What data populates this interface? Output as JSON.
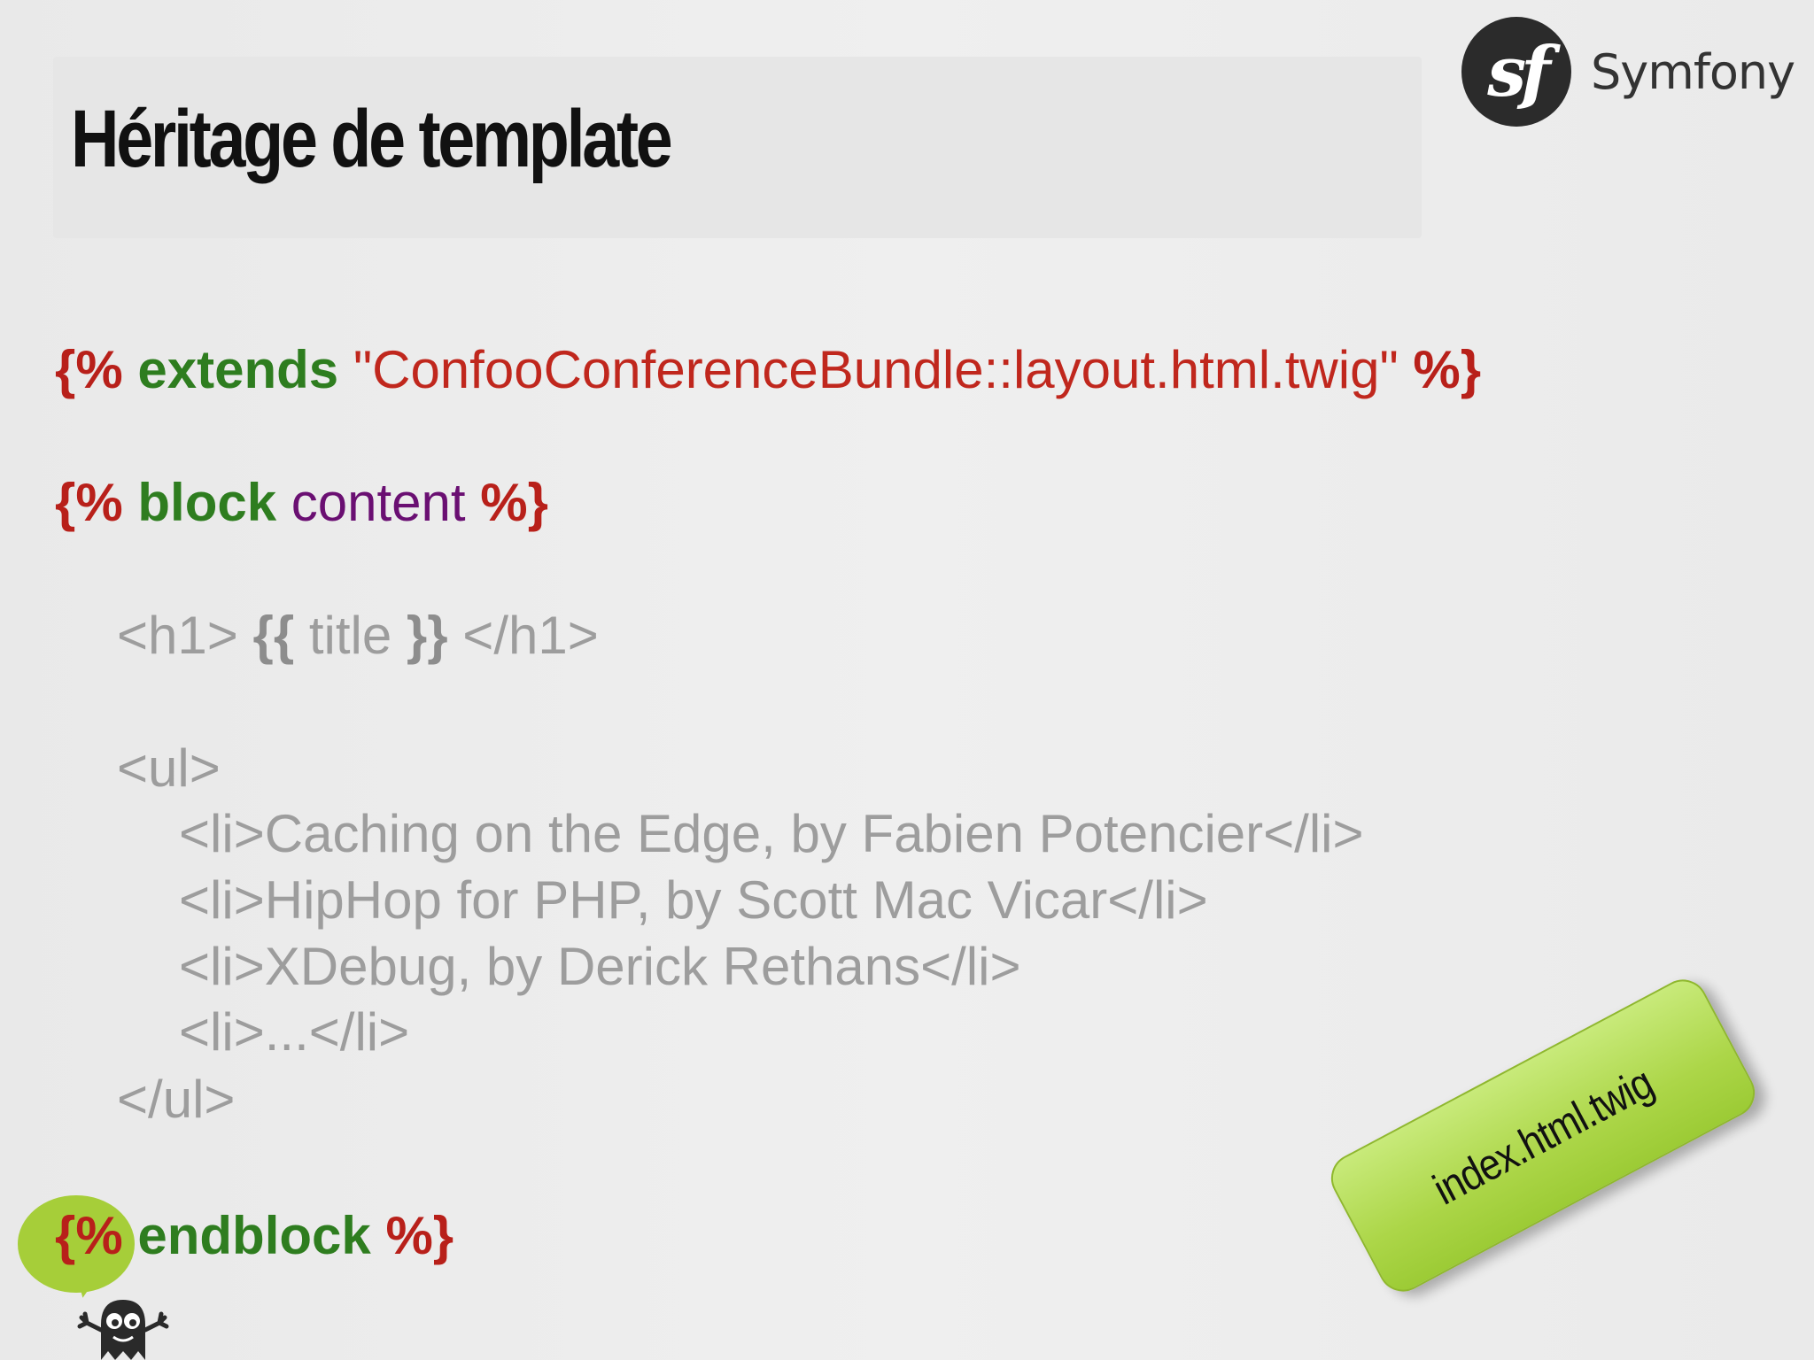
{
  "slide": {
    "title": "Héritage de template",
    "logo": {
      "mark": "sf",
      "brand": "Symfony"
    },
    "code": {
      "extends_open": "{%",
      "extends_kw": "extends",
      "extends_str": "\"ConfooConferenceBundle::layout.html.twig\"",
      "extends_close": "%}",
      "block_open": "{%",
      "block_kw": "block",
      "block_name": "content",
      "block_close": "%}",
      "h1_open": "<h1>",
      "var_open": "{{",
      "var_name": "title",
      "var_close": "}}",
      "h1_close": "</h1>",
      "ul_open": "<ul>",
      "items": [
        "<li>Caching on the Edge, by Fabien Potencier</li>",
        "<li>HipHop for PHP, by Scott Mac Vicar</li>",
        "<li>XDebug, by Derick Rethans</li>",
        "<li>...</li>"
      ],
      "ul_close": "</ul>",
      "endblock_open": "{%",
      "endblock_kw": "endblock",
      "endblock_close": "%}"
    },
    "sticky_note": "index.html.twig",
    "mascot_icon": "ghost-mascot-icon"
  }
}
